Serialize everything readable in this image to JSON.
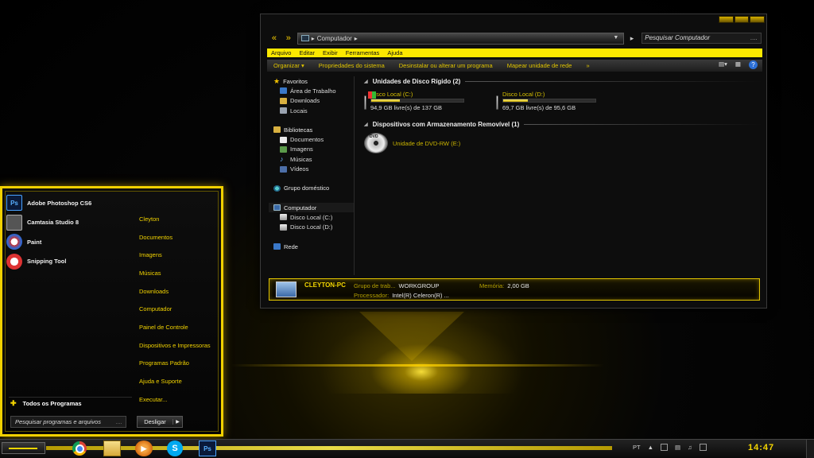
{
  "explorer": {
    "address": "Computador",
    "search_placeholder": "Pesquisar Computador",
    "search_dots": "....",
    "menu": [
      "Arquivo",
      "Editar",
      "Exibir",
      "Ferramentas",
      "Ajuda"
    ],
    "commands": [
      "Organizar ▾",
      "Propriedades do sistema",
      "Desinstalar ou alterar um programa",
      "Mapear unidade de rede",
      "»"
    ],
    "nav": {
      "favorites": "Favoritos",
      "favorites_items": [
        "Área de Trabalho",
        "Downloads",
        "Locais"
      ],
      "libraries": "Bibliotecas",
      "libraries_items": [
        "Documentos",
        "Imagens",
        "Músicas",
        "Vídeos"
      ],
      "homegroup": "Grupo doméstico",
      "computer": "Computador",
      "computer_items": [
        "Disco Local (C:)",
        "Disco Local (D:)"
      ],
      "network": "Rede"
    },
    "hard_disks_header": "Unidades de Disco Rígido (2)",
    "drives": [
      {
        "name": "Disco Local (C:)",
        "free": "94,9 GB livre(s) de 137 GB",
        "used_fraction": 0.31
      },
      {
        "name": "Disco Local (D:)",
        "free": "69,7 GB livre(s) de 95,6 GB",
        "used_fraction": 0.27
      }
    ],
    "removable_header": "Dispositivos com Armazenamento Removível (1)",
    "dvd": {
      "label": "DVD",
      "name": "Unidade de DVD-RW (E:)"
    },
    "details": {
      "pc_name": "CLEYTON-PC",
      "workgroup_label": "Grupo de trab...",
      "workgroup_value": "WORKGROUP",
      "memory_label": "Memória:",
      "memory_value": "2,00 GB",
      "processor_label": "Processador:",
      "processor_value": "Intel(R) Celeron(R) ..."
    }
  },
  "start_menu": {
    "programs": [
      {
        "name": "Adobe Photoshop CS6",
        "icon": "Ps"
      },
      {
        "name": "Camtasia Studio 8",
        "icon": ""
      },
      {
        "name": "Paint",
        "icon": ""
      },
      {
        "name": "Snipping Tool",
        "icon": ""
      }
    ],
    "all_programs": "Todos os Programas",
    "search_placeholder": "Pesquisar programas e arquivos",
    "search_dots": "....",
    "shutdown": "Desligar",
    "places": [
      "Cleyton",
      "Documentos",
      "Imagens",
      "Músicas",
      "Downloads",
      "Computador",
      "Painel de Controle",
      "Dispositivos e Impressoras",
      "Programas Padrão",
      "Ajuda e Suporte",
      "Executar..."
    ]
  },
  "taskbar": {
    "icons": [
      "chrome-icon",
      "folder-icon",
      "media-player-icon",
      "skype-icon",
      "photoshop-icon"
    ],
    "photoshop_label": "Ps",
    "language": "PT",
    "clock": "14:47"
  },
  "colors": {
    "accent": "#f5d400",
    "background": "#000000"
  }
}
